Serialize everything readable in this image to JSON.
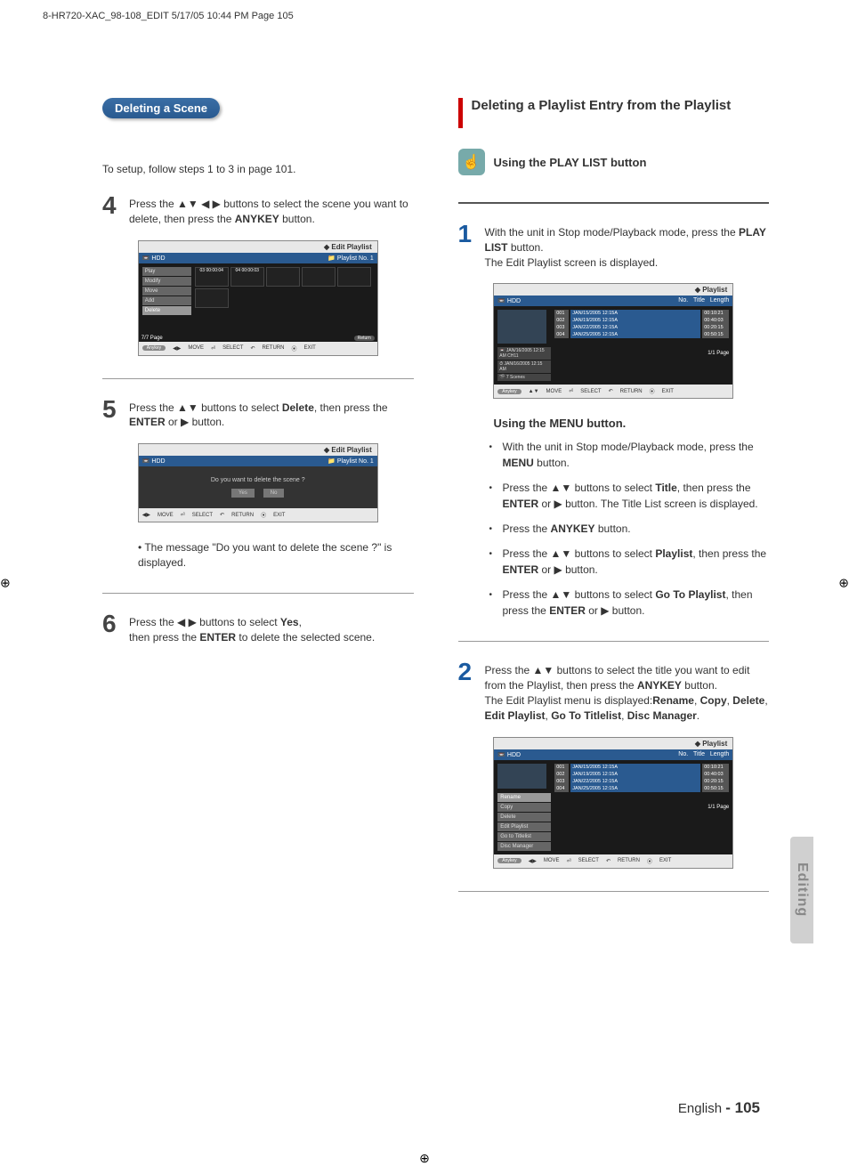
{
  "print_header": "8-HR720-XAC_98-108_EDIT  5/17/05  10:44 PM  Page 105",
  "side_tab": "Editing",
  "page_foot_lang": "English",
  "page_foot_num": "- 105",
  "left": {
    "pill": "Deleting a Scene",
    "intro": "To setup, follow steps 1 to 3 in page 101.",
    "step4_num": "4",
    "step4_text_a": "Press the ▲▼ ◀ ▶ buttons to select the scene you want to delete, then press the ",
    "step4_text_b": "ANYKEY",
    "step4_text_c": " button.",
    "step5_num": "5",
    "step5_text_a": "Press the ▲▼ buttons to select ",
    "step5_text_b": "Delete",
    "step5_text_c": ", then press the ",
    "step5_text_d": "ENTER",
    "step5_text_e": " or ▶ button.",
    "step5_note": "The message \"Do you want to delete the scene ?\" is displayed.",
    "step6_num": "6",
    "step6_text_a": "Press the ◀ ▶ buttons to select ",
    "step6_text_b": "Yes",
    "step6_text_c": ",",
    "step6_text_d": "then press the ",
    "step6_text_e": "ENTER",
    "step6_text_f": " to delete the selected scene.",
    "screen1": {
      "title": "Edit Playlist",
      "hdd": "HDD",
      "sub": "Playlist No. 1",
      "menu": [
        "Play",
        "Modify",
        "Move",
        "Add",
        "Delete"
      ],
      "thumbs": [
        "03",
        "04"
      ],
      "thumb_t1": "00:00:04",
      "thumb_t2": "00:00:03",
      "page": "7/7 Page",
      "return": "Return",
      "footer": [
        "MOVE",
        "SELECT",
        "RETURN",
        "EXIT"
      ],
      "tag": "Anykey"
    },
    "screen2": {
      "title": "Edit Playlist",
      "hdd": "HDD",
      "sub": "Playlist No. 1",
      "msg": "Do you want to delete the scene ?",
      "yes": "Yes",
      "no": "No",
      "footer": [
        "MOVE",
        "SELECT",
        "RETURN",
        "EXIT"
      ]
    }
  },
  "right": {
    "title": "Deleting a Playlist Entry from the Playlist",
    "using": "Using the PLAY LIST button",
    "step1_num": "1",
    "step1_a": "With the unit in Stop mode/Playback mode, press the ",
    "step1_b": "PLAY LIST",
    "step1_c": " button.",
    "step1_d": "The Edit Playlist screen is displayed.",
    "menu_heading": "Using the MENU button.",
    "b1_a": "With the unit in Stop mode/Playback mode, press the ",
    "b1_b": "MENU",
    "b1_c": " button.",
    "b2_a": "Press the ▲▼ buttons to select ",
    "b2_b": "Title",
    "b2_c": ", then press the ",
    "b2_d": "ENTER",
    "b2_e": " or ▶ button. The Title List screen is displayed.",
    "b3_a": "Press the ",
    "b3_b": "ANYKEY",
    "b3_c": " button.",
    "b4_a": "Press the ▲▼ buttons to select ",
    "b4_b": "Playlist",
    "b4_c": ", then press the ",
    "b4_d": "ENTER",
    "b4_e": " or ▶ button.",
    "b5_a": "Press the ▲▼ buttons to select ",
    "b5_b": "Go To Playlist",
    "b5_c": ", then press the ",
    "b5_d": "ENTER",
    "b5_e": " or ▶ button.",
    "step2_num": "2",
    "step2_a": "Press the ▲▼ buttons to select the title you want to edit from the Playlist, then press the ",
    "step2_b": "ANYKEY",
    "step2_c": " button.",
    "step2_d": "The Edit Playlist menu is displayed:",
    "step2_e": "Rename",
    "step2_f": "Copy",
    "step2_g": "Delete",
    "step2_h": "Edit Playlist",
    "step2_i": "Go To Titlelist",
    "step2_j": "Disc Manager",
    "screen3": {
      "title": "Playlist",
      "hdd": "HDD",
      "cols": [
        "No.",
        "Title",
        "Length"
      ],
      "rows": [
        {
          "n": "001",
          "t": "JAN/15/2005 12:15A",
          "l": "00:10:21"
        },
        {
          "n": "002",
          "t": "JAN/19/2005 12:15A",
          "l": "00:40:03"
        },
        {
          "n": "003",
          "t": "JAN/22/2005 12:15A",
          "l": "00:20:15"
        },
        {
          "n": "004",
          "t": "JAN/25/2005 12:15A",
          "l": "00:50:15"
        }
      ],
      "info1": "JAN/16/2005 12:15 AM CH11",
      "info2": "JAN/16/2005 12:15 AM",
      "info3": "7 Scenes",
      "page": "1/1 Page",
      "footer": [
        "MOVE",
        "SELECT",
        "RETURN",
        "EXIT"
      ],
      "tag": "Anykey"
    },
    "screen4": {
      "title": "Playlist",
      "hdd": "HDD",
      "cols": [
        "No.",
        "Title",
        "Length"
      ],
      "rows": [
        {
          "n": "001",
          "t": "JAN/15/2005 12:15A",
          "l": "00:10:21"
        },
        {
          "n": "002",
          "t": "JAN/19/2005 12:15A",
          "l": "00:40:03"
        },
        {
          "n": "003",
          "t": "JAN/22/2005 12:15A",
          "l": "00:20:15"
        },
        {
          "n": "004",
          "t": "JAN/25/2005 12:15A",
          "l": "00:50:15"
        }
      ],
      "menu": [
        "Rename",
        "Copy",
        "Delete",
        "Edit Playlist",
        "Go to Titlelist",
        "Disc Manager"
      ],
      "page": "1/1 Page",
      "footer": [
        "MOVE",
        "SELECT",
        "RETURN",
        "EXIT"
      ],
      "tag": "Anykey"
    }
  }
}
